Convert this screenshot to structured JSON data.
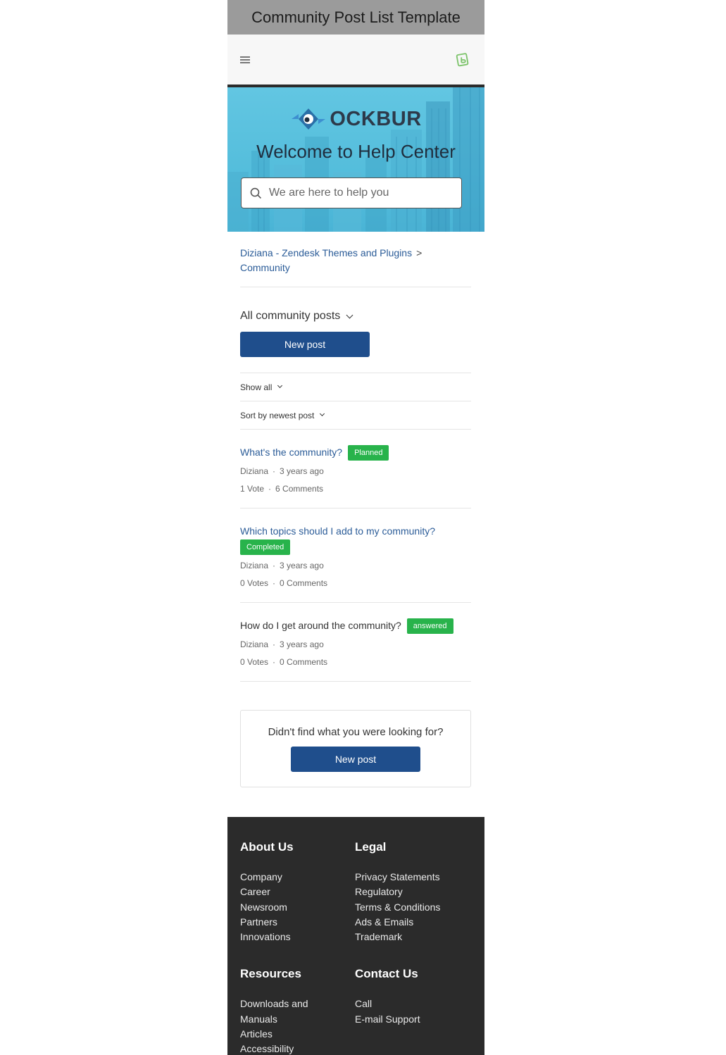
{
  "page_title": "Community Post List Template",
  "brand": {
    "logo_text": "OCKBUR"
  },
  "hero": {
    "title": "Welcome to Help Center",
    "search_placeholder": "We are here to help you"
  },
  "breadcrumbs": [
    {
      "label": "Diziana - Zendesk Themes and Plugins"
    },
    {
      "label": "Community"
    }
  ],
  "filter_title": "All community posts",
  "new_post_label": "New post",
  "filters": {
    "show": "Show all",
    "sort": "Sort by newest post"
  },
  "posts": [
    {
      "title": "What's the community?",
      "badge": "Planned",
      "author": "Diziana",
      "time": "3 years ago",
      "votes": "1 Vote",
      "comments": "6 Comments"
    },
    {
      "title": "Which topics should I add to my community?",
      "badge": "Completed",
      "author": "Diziana",
      "time": "3 years ago",
      "votes": "0 Votes",
      "comments": "0 Comments"
    },
    {
      "title": "How do I get around the community?",
      "badge": "answered",
      "author": "Diziana",
      "time": "3 years ago",
      "votes": "0 Votes",
      "comments": "0 Comments"
    }
  ],
  "help_box": {
    "question": "Didn't find what you were looking for?",
    "button": "New post"
  },
  "footer": {
    "about": {
      "title": "About Us",
      "items": [
        "Company",
        "Career",
        "Newsroom",
        "Partners",
        "Innovations"
      ]
    },
    "legal": {
      "title": "Legal",
      "items": [
        "Privacy Statements",
        "Regulatory",
        "Terms & Conditions",
        "Ads & Emails",
        "Trademark"
      ]
    },
    "resources": {
      "title": "Resources",
      "items": [
        "Downloads and",
        "Manuals",
        "Articles",
        "Accessibility"
      ]
    },
    "contact": {
      "title": "Contact Us",
      "items": [
        "Call",
        "E-mail Support"
      ]
    }
  },
  "colors": {
    "primary_button": "#1f4e8c",
    "link": "#2b5c98",
    "badge_green": "#28b34b",
    "footer_bg": "#2b2b2b",
    "hero_bg": "#55bedc"
  },
  "icons": [
    "hamburger-menu-icon",
    "brand-app-icon",
    "search-icon",
    "chevron-down-icon"
  ]
}
